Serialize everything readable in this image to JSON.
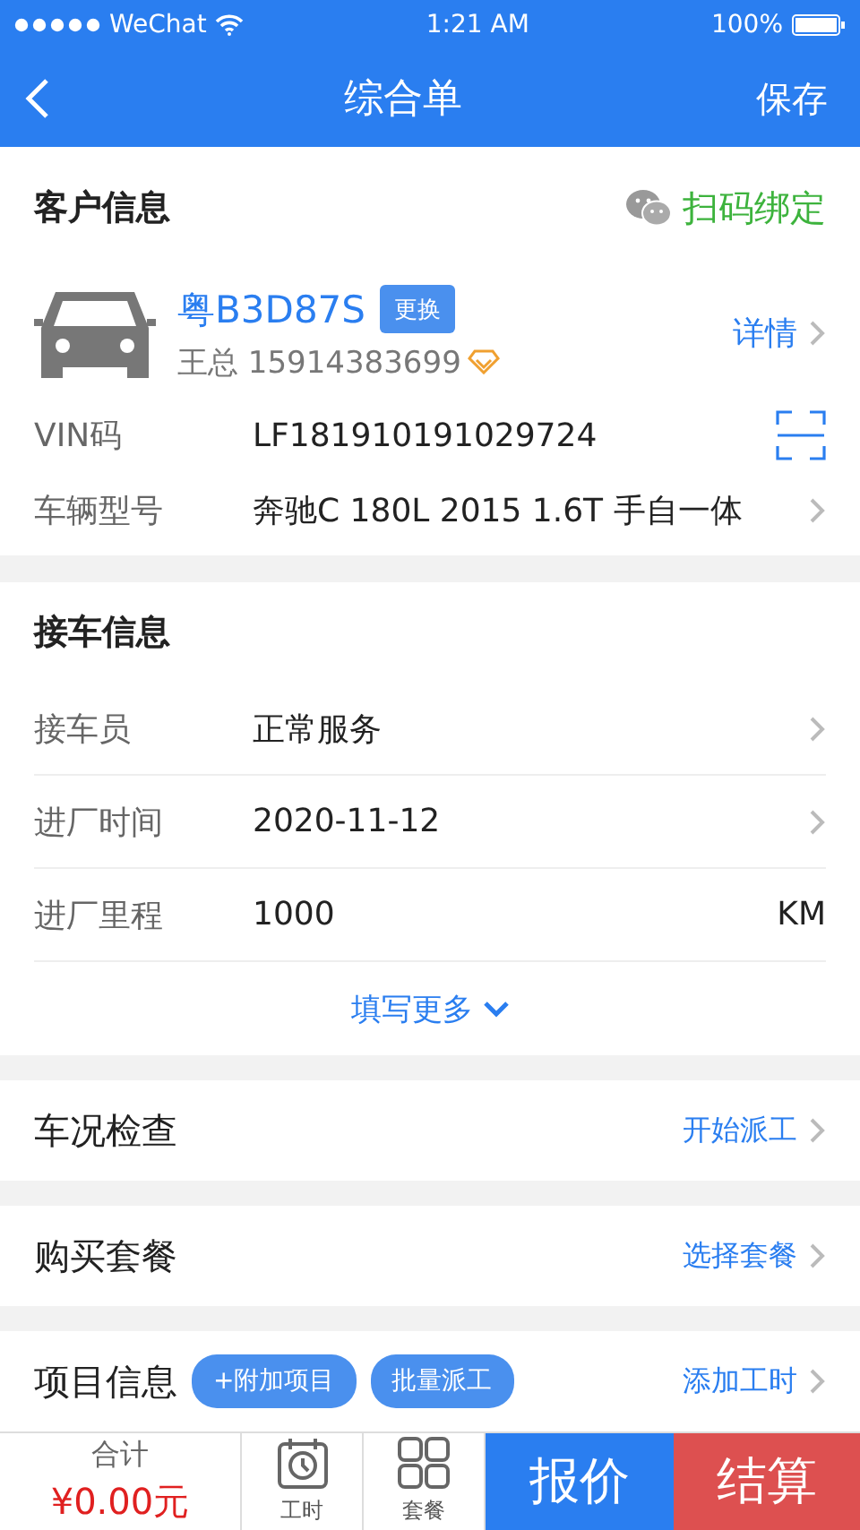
{
  "status_bar": {
    "carrier": "WeChat",
    "time": "1:21 AM",
    "battery": "100%"
  },
  "nav": {
    "title": "综合单",
    "action": "保存"
  },
  "customer": {
    "title": "客户信息",
    "bind": "扫码绑定",
    "plate": "粤B3D87S",
    "change": "更换",
    "owner": "王总 15914383699",
    "details": "详情",
    "fields": [
      {
        "label": "VIN码",
        "value": "LF181910191029724",
        "kind": "scan"
      },
      {
        "label": "车辆型号",
        "value": "奔驰C 180L 2015 1.6T 手自一体",
        "kind": "link"
      }
    ]
  },
  "pickup": {
    "title": "接车信息",
    "rows": [
      {
        "label": "接车员",
        "value": "正常服务",
        "kind": "link"
      },
      {
        "label": "进厂时间",
        "value": "2020-11-12",
        "kind": "link"
      },
      {
        "label": "进厂里程",
        "value": "1000",
        "unit": "KM",
        "kind": "unit"
      }
    ],
    "more": "填写更多"
  },
  "sections": [
    {
      "title": "车况检查",
      "action": "开始派工"
    },
    {
      "title": "购买套餐",
      "action": "选择套餐"
    },
    {
      "title": "项目信息",
      "action": "添加工时",
      "chips": [
        "+附加项目",
        "批量派工"
      ]
    }
  ],
  "bottom": {
    "total_label": "合计",
    "total": "¥0.00元",
    "tabs": [
      {
        "label": "工时",
        "kind": "clock"
      },
      {
        "label": "套餐",
        "kind": "grid"
      }
    ],
    "quote": "报价",
    "settle": "结算"
  }
}
